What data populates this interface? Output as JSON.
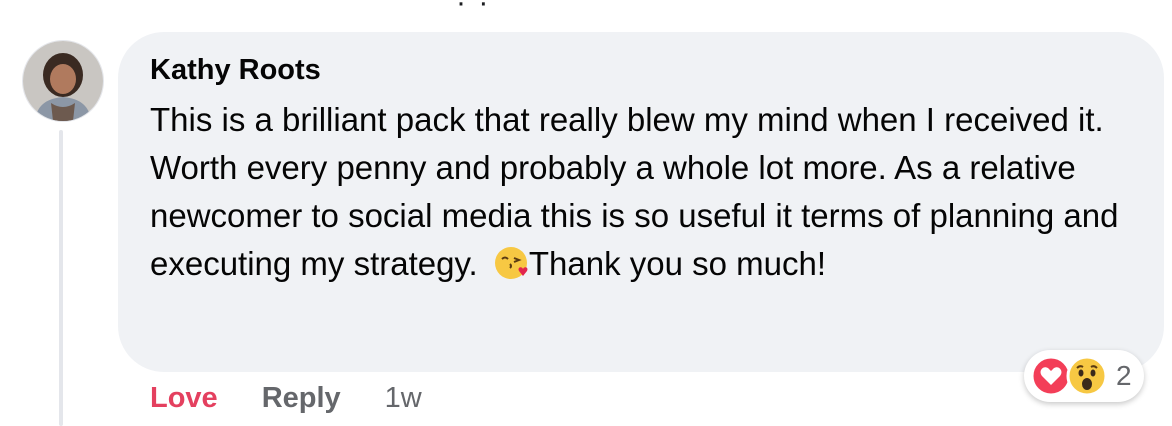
{
  "comment": {
    "author": "Kathy Roots",
    "text_before_emoji": "This is a brilliant pack that really blew my mind when I received it. Worth every penny and probably a whole lot more. As a relative newcomer to social media this is so useful it terms of planning and executing my strategy.",
    "text_after_emoji": "Thank you so much!",
    "emoji": "face-blowing-a-kiss-icon"
  },
  "actions": {
    "love_label": "Love",
    "reply_label": "Reply",
    "timestamp": "1w"
  },
  "reactions": {
    "icons": [
      "love-reaction-icon",
      "wow-reaction-icon"
    ],
    "count": "2"
  },
  "colors": {
    "bubble_bg": "#f0f2f5",
    "love_red": "#e4405f",
    "muted_gray": "#65676b",
    "reaction_yellow": "#f7c843"
  }
}
